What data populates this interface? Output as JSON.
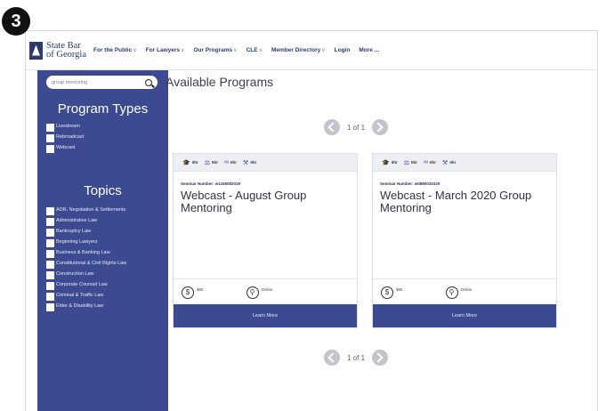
{
  "step_number": "3",
  "nav": {
    "logo_line1": "State Bar",
    "logo_line2": "of Georgia",
    "items": [
      {
        "label": "For the Public",
        "chevron": true
      },
      {
        "label": "For Lawyers",
        "chevron": true
      },
      {
        "label": "Our Programs",
        "chevron": true
      },
      {
        "label": "CLE",
        "chevron": true
      },
      {
        "label": "Member Directory",
        "chevron": true
      },
      {
        "label": "Login",
        "chevron": false
      },
      {
        "label": "More ...",
        "chevron": false
      }
    ]
  },
  "sidebar": {
    "search_value": "group mentoring",
    "program_types_heading": "Program Types",
    "program_types": [
      "Livestream",
      "Rebroadcast",
      "Webcast"
    ],
    "topics_heading": "Topics",
    "topics": [
      "ADR, Negotiation & Settlements",
      "Administrative Law",
      "Bankruptcy Law",
      "Beginning Lawyers",
      "Business & Banking Law",
      "Constitutional & Civil Rights Law",
      "Construction Law",
      "Corporate Counsel Law",
      "Criminal & Traffic Law",
      "Elder & Disability Law"
    ]
  },
  "main": {
    "title": "Available Programs",
    "pager_text": "1 of 1"
  },
  "cards": [
    {
      "credits": [
        "0hr",
        "0hr",
        "0hr",
        "0hr"
      ],
      "seminar": "Seminar Number: w1165082019",
      "title": "Webcast - August Group Mentoring",
      "price": "$65",
      "mode": "Online",
      "button": "Learn More"
    },
    {
      "credits": [
        "0hr",
        "0hr",
        "0hr",
        "0hr"
      ],
      "seminar": "Seminar Number: w0880031020",
      "title": "Webcast - March 2020 Group Mentoring",
      "price": "$65",
      "mode": "Online",
      "button": "Learn More"
    }
  ],
  "colors": {
    "sidebar": "#3c4a92",
    "brand_text": "#2d3a6e",
    "pager_gray": "#c2c5cc"
  }
}
